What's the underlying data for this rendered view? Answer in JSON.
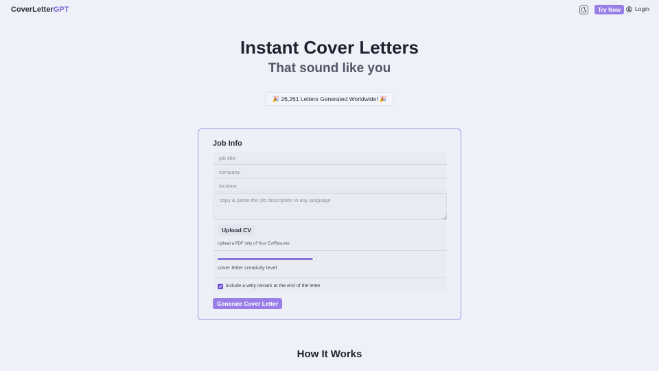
{
  "header": {
    "logo_main": "CoverLetter",
    "logo_accent": "GPT",
    "theme_icon": "moon-icon",
    "try_now_label": "Try Now",
    "login_label": "Login",
    "login_icon": "user-circle-icon"
  },
  "hero": {
    "title": "Instant Cover Letters",
    "subtitle": "That sound like you",
    "counter": "🎉 26,261 Letters Generated Worldwide! 🎉"
  },
  "form": {
    "title": "Job Info",
    "job_title_placeholder": "job title",
    "company_placeholder": "company",
    "location_placeholder": "location",
    "description_placeholder": "copy & paste the job description in any language",
    "upload_label": "Upload CV",
    "upload_hint": "Upload a PDF only of Your CV/Resume",
    "creativity_label": "cover letter creativity level",
    "creativity_value": 0.97,
    "witty_label": "include a witty remark at the end of the letter",
    "witty_checked": true,
    "generate_label": "Generate Cover Letter"
  },
  "how_it_works": {
    "title": "How It Works"
  },
  "colors": {
    "accent": "#9a7ee8",
    "accent_dark": "#6c4fd0",
    "background": "#eff1f8"
  }
}
